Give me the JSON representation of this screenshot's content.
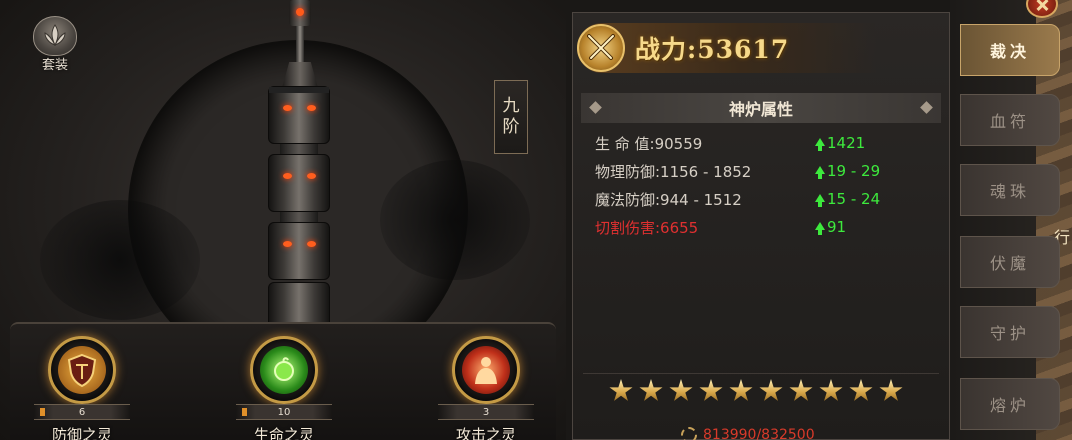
{
  "suit_button": {
    "label": "套装"
  },
  "tier": {
    "chars": [
      "九",
      "阶"
    ]
  },
  "spirits": [
    {
      "name": "防御之灵",
      "level": "6",
      "icon": "shield-icon"
    },
    {
      "name": "生命之灵",
      "level": "10",
      "icon": "life-orb-icon"
    },
    {
      "name": "攻击之灵",
      "level": "3",
      "icon": "attack-figure-icon"
    }
  ],
  "power": {
    "label": "战力:",
    "value": "53617"
  },
  "attributes": {
    "title": "神炉属性",
    "rows": [
      {
        "label": "生 命 值:90559",
        "gain": "1421",
        "red": false
      },
      {
        "label": "物理防御:1156 - 1852",
        "gain": "19 - 29",
        "red": false
      },
      {
        "label": "魔法防御:944 - 1512",
        "gain": "15 - 24",
        "red": false
      },
      {
        "label": "切割伤害:6655",
        "gain": "91",
        "red": true
      }
    ]
  },
  "stars": {
    "count": 10,
    "filled": 10
  },
  "exp": {
    "value": "813990/832500"
  },
  "tabs": [
    {
      "label": "裁决",
      "active": true
    },
    {
      "label": "血符",
      "active": false
    },
    {
      "label": "魂珠",
      "active": false
    },
    {
      "label": "伏魔",
      "active": false
    },
    {
      "label": "守护",
      "active": false
    },
    {
      "label": "熔炉",
      "active": false
    }
  ],
  "side_text": "行",
  "colors": {
    "gold": "#f6d98a",
    "gain_green": "#3dea3d",
    "damage_red": "#e03030"
  }
}
